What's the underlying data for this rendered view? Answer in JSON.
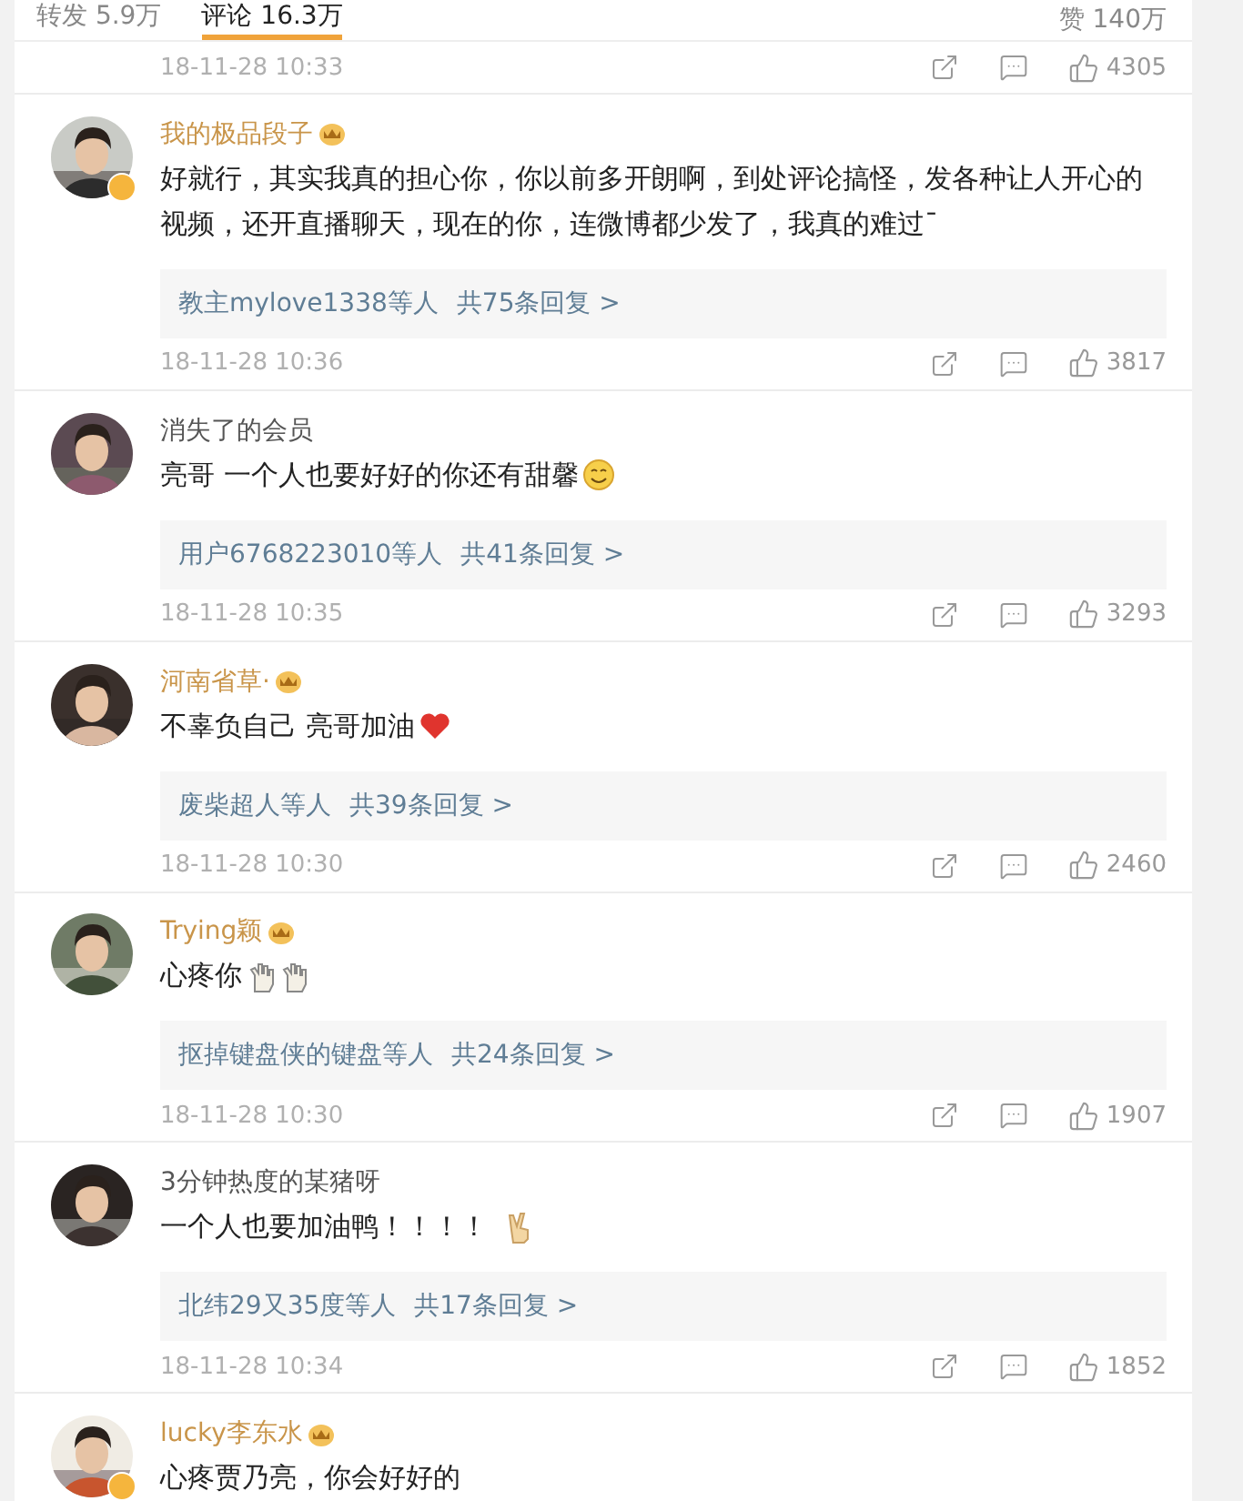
{
  "tabs": [
    {
      "label": "转发",
      "count": "5.9万",
      "selected": false
    },
    {
      "label": "评论",
      "count": "16.3万",
      "selected": true
    }
  ],
  "likes_tab": {
    "label": "赞",
    "count": "140万"
  },
  "previous_footer": {
    "time": "18-11-28 10:33",
    "likes": "4305"
  },
  "comments": [
    {
      "name": "我的极品段子",
      "vip": true,
      "verified": true,
      "text": "好就行，其实我真的担心你，你以前多开朗啊，到处评论搞怪，发各种让人开心的视频，还开直播聊天，现在的你，连微博都少发了，我真的难过ˉ",
      "reply_users": "教主mylove1338等人",
      "reply_count": "共75条回复 >",
      "time": "18-11-28 10:36",
      "likes": "3817"
    },
    {
      "name": "消失了的会员",
      "vip": false,
      "verified": false,
      "text": "亮哥 一个人也要好好的你还有甜馨",
      "emojis": [
        {
          "kind": "smile"
        }
      ],
      "reply_users": "用户6768223010等人",
      "reply_count": "共41条回复 >",
      "time": "18-11-28 10:35",
      "likes": "3293"
    },
    {
      "name": "河南省草·",
      "vip": true,
      "verified": false,
      "text": "不辜负自己 亮哥加油",
      "emojis": [
        {
          "kind": "heart"
        }
      ],
      "reply_users": "废柴超人等人",
      "reply_count": "共39条回复 >",
      "time": "18-11-28 10:30",
      "likes": "2460"
    },
    {
      "name": "Trying颖",
      "vip": true,
      "verified": false,
      "text": "心疼你",
      "emojis": [
        {
          "kind": "hand"
        },
        {
          "kind": "hand"
        }
      ],
      "reply_users": "抠掉键盘侠的键盘等人",
      "reply_count": "共24条回复 >",
      "time": "18-11-28 10:30",
      "likes": "1907"
    },
    {
      "name": "3分钟热度的某猪呀",
      "vip": false,
      "verified": false,
      "text": "一个人也要加油鸭！！！！",
      "emojis": [
        {
          "kind": "victory"
        }
      ],
      "reply_users": "北纬29又35度等人",
      "reply_count": "共17条回复 >",
      "time": "18-11-28 10:34",
      "likes": "1852"
    },
    {
      "name": "lucky李东水",
      "vip": true,
      "verified": true,
      "text": "心疼贾乃亮，你会好好的"
    }
  ]
}
